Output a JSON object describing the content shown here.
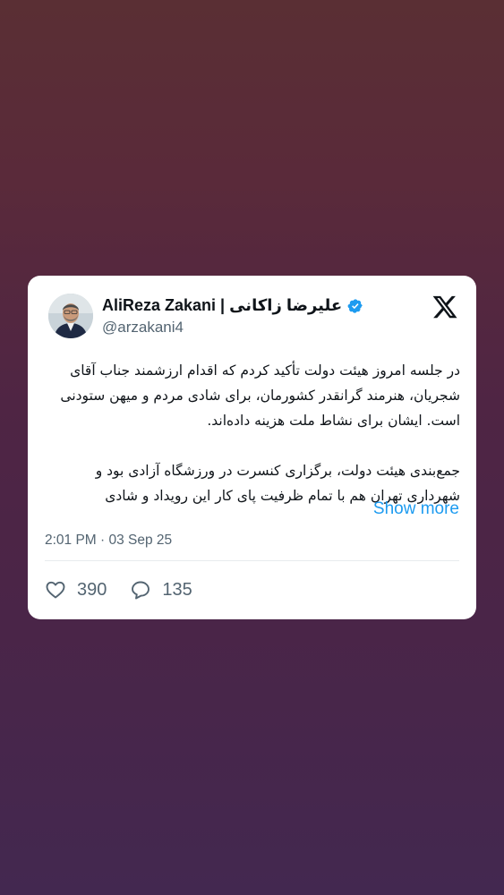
{
  "tweet": {
    "author_name": "AliReza Zakani | علیرضا زاکانی",
    "handle": "@arzakani4",
    "paragraphs": [
      "در جلسه امروز هیئت دولت تأکید کردم که اقدام ارزشمند جناب آقای شجریان، هنرمند گرانقدر کشورمان، برای شادی مردم و میهن ستودنی است. ایشان برای نشاط ملت هزینه داده‌اند.",
      "جمع‌بندی هیئت دولت، برگزاری کنسرت در ورزشگاه آزادی بود و شهرداری تهران هم با تمام ظرفیت پای کار این رویداد و شادی"
    ],
    "show_more": "Show more",
    "timestamp": "2:01 PM · 03 Sep 25",
    "likes": "390",
    "replies": "135"
  },
  "icons": {
    "verified": "verified-badge-icon",
    "logo": "x-logo-icon",
    "like": "heart-icon",
    "reply": "comment-icon"
  },
  "colors": {
    "link": "#1d9bf0",
    "verified": "#1d9bf0",
    "muted": "#536471",
    "text": "#0f1419"
  }
}
